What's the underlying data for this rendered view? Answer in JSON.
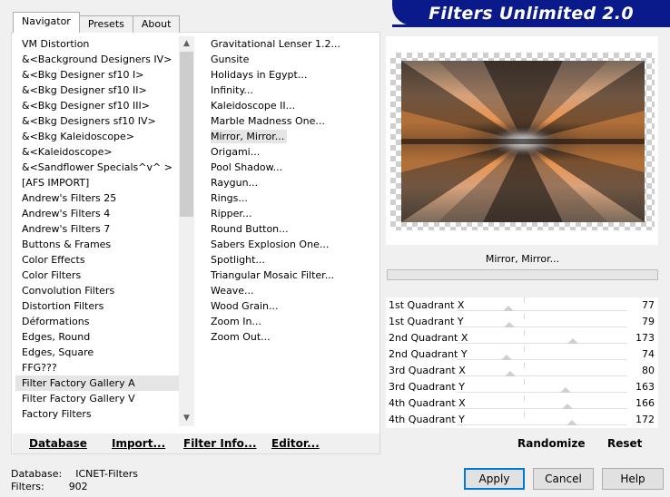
{
  "banner": {
    "title": "Filters Unlimited 2.0",
    "color": "#0a1a8a"
  },
  "tabs": [
    {
      "label": "Navigator",
      "active": true
    },
    {
      "label": "Presets",
      "active": false
    },
    {
      "label": "About",
      "active": false
    }
  ],
  "categories": [
    "VM Distortion",
    "&<Background Designers IV>",
    "&<Bkg Designer sf10 I>",
    "&<Bkg Designer sf10 II>",
    "&<Bkg Designer sf10 III>",
    "&<Bkg Designers sf10 IV>",
    "&<Bkg Kaleidoscope>",
    "&<Kaleidoscope>",
    "&<Sandflower Specials^v^ >",
    "[AFS IMPORT]",
    "Andrew's Filters 25",
    "Andrew's Filters 4",
    "Andrew's Filters 7",
    "Buttons & Frames",
    "Color Effects",
    "Color Filters",
    "Convolution Filters",
    "Distortion Filters",
    "Déformations",
    "Edges, Round",
    "Edges, Square",
    "FFG???",
    "Filter Factory Gallery A",
    "Filter Factory Gallery V",
    "Factory Filters"
  ],
  "selected_category": "Filter Factory Gallery A",
  "filters": [
    "Gravitational Lenser 1.2...",
    "Gunsite",
    "Holidays in Egypt...",
    "Infinity...",
    "Kaleidoscope II...",
    "Marble Madness One...",
    "Mirror, Mirror...",
    "Origami...",
    "Pool Shadow...",
    "Raygun...",
    "Rings...",
    "Ripper...",
    "Round Button...",
    "Sabers Explosion One...",
    "Spotlight...",
    "Triangular Mosaic Filter...",
    "Weave...",
    "Wood Grain...",
    "Zoom In...",
    "Zoom Out..."
  ],
  "selected_filter": "Mirror, Mirror...",
  "scroll_icons": {
    "up": "chevron-up-icon",
    "down": "chevron-down-icon"
  },
  "bottom_buttons": {
    "database": "Database",
    "import": "Import...",
    "filter_info": "Filter Info...",
    "editor": "Editor..."
  },
  "preview": {
    "filter_name": "Mirror, Mirror..."
  },
  "params": [
    {
      "label": "1st Quadrant X",
      "value": "77"
    },
    {
      "label": "1st Quadrant Y",
      "value": "79"
    },
    {
      "label": "2nd Quadrant X",
      "value": "173"
    },
    {
      "label": "2nd Quadrant Y",
      "value": "74"
    },
    {
      "label": "3rd Quadrant X",
      "value": "80"
    },
    {
      "label": "3rd Quadrant Y",
      "value": "163"
    },
    {
      "label": "4th Quadrant X",
      "value": "166"
    },
    {
      "label": "4th Quadrant Y",
      "value": "172"
    }
  ],
  "randomize": "Randomize",
  "reset": "Reset",
  "status": {
    "database_label": "Database:",
    "database_value": "ICNET-Filters",
    "filters_label": "Filters:",
    "filters_value": "902"
  },
  "dialog_buttons": {
    "apply": "Apply",
    "cancel": "Cancel",
    "help": "Help"
  }
}
